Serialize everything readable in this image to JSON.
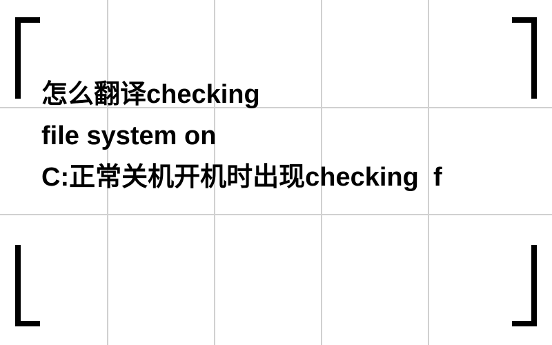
{
  "question": {
    "line1": "怎么翻译checking",
    "line2": "file system on",
    "line3_prefix": " C:正常关机开机时出现checking",
    "line3_suffix": "f"
  }
}
